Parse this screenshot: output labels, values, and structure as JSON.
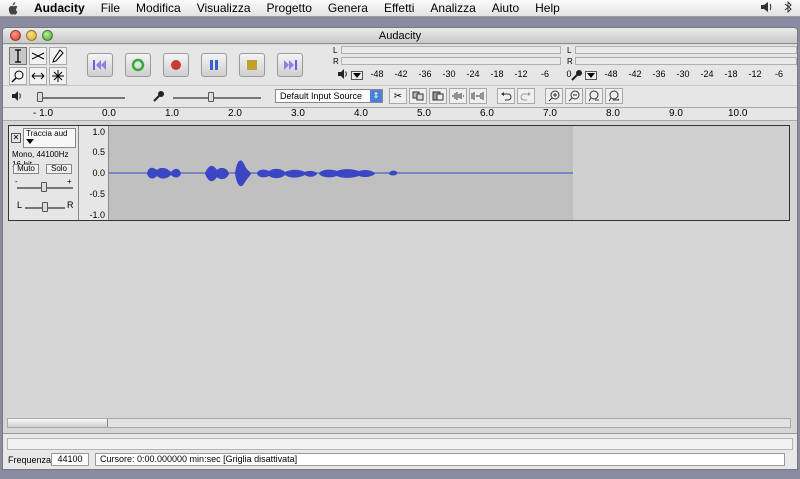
{
  "menubar": {
    "app": "Audacity",
    "items": [
      "File",
      "Modifica",
      "Visualizza",
      "Progetto",
      "Genera",
      "Effetti",
      "Analizza",
      "Aiuto",
      "Help"
    ]
  },
  "window": {
    "title": "Audacity"
  },
  "meters": {
    "L": "L",
    "R": "R",
    "scale": [
      "-48",
      "-42",
      "-36",
      "-30",
      "-24",
      "-18",
      "-12",
      "-6",
      "0"
    ]
  },
  "input_source": "Default Input Source",
  "ruler": {
    "labels": [
      "- 1.0",
      "0.0",
      "1.0",
      "2.0",
      "3.0",
      "4.0",
      "5.0",
      "6.0",
      "7.0",
      "8.0",
      "9.0",
      "10.0"
    ]
  },
  "track": {
    "name": "Traccia aud",
    "info_line1": "Mono, 44100Hz",
    "info_line2": "16-bit",
    "mute_label": "Muto",
    "solo_label": "Solo",
    "pan_left": "L",
    "pan_right": "R",
    "gain_minus": "-",
    "gain_plus": "+",
    "scale": [
      "1.0",
      "0.5",
      "0.0",
      "-0.5",
      "-1.0"
    ]
  },
  "status": {
    "rate_label": "Frequenza:",
    "rate_value": "44100",
    "cursor_text": "Cursore: 0:00.000000 min:sec   [Griglia disattivata]"
  },
  "colors": {
    "waveform": "#3b46c4",
    "workspace": "#8a8aa0"
  }
}
